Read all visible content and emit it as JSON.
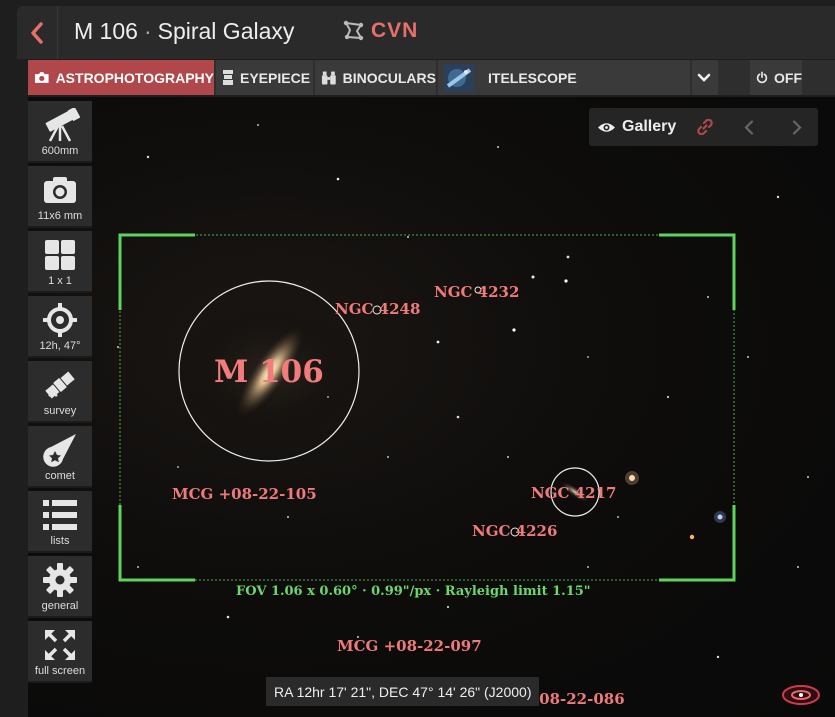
{
  "header": {
    "object_name": "M 106",
    "separator": "·",
    "object_type": "Spiral Galaxy",
    "constellation": "CVN"
  },
  "modes": [
    {
      "label": "ASTROPHOTOGRAPHY",
      "icon": "camera-icon",
      "active": true
    },
    {
      "label": "EYEPIECE",
      "icon": "eyepiece-icon",
      "active": false
    },
    {
      "label": "BINOCULARS",
      "icon": "binoculars-icon",
      "active": false
    },
    {
      "label": "ITELESCOPE",
      "icon": "itelescope-icon",
      "active": false
    }
  ],
  "power": {
    "label": "OFF"
  },
  "sidebar": [
    {
      "label": "600mm",
      "icon": "telescope-icon"
    },
    {
      "label": "11x6 mm",
      "icon": "camera-icon"
    },
    {
      "label": "1 x 1",
      "icon": "grid-icon"
    },
    {
      "label": "12h, 47°",
      "icon": "crosshair-icon"
    },
    {
      "label": "survey",
      "icon": "satellite-icon"
    },
    {
      "label": "comet",
      "icon": "comet-icon"
    },
    {
      "label": "lists",
      "icon": "list-icon"
    },
    {
      "label": "general",
      "icon": "gear-icon"
    },
    {
      "label": "full screen",
      "icon": "fullscreen-icon"
    }
  ],
  "gallery": {
    "label": "Gallery"
  },
  "objects": {
    "main": "M 106",
    "ngc4248": "NGC 4248",
    "ngc4232": "NGC 4232",
    "ngc4217": "NGC 4217",
    "ngc4226": "NGC 4226",
    "mcg105": "MCG +08-22-105",
    "mcg097": "MCG +08-22-097",
    "mcg086": "MCG +08-22-086"
  },
  "fov": "FOV 1.06 x 0.60° · 0.99\"/px · Rayleigh limit 1.15\"",
  "coordinates": "RA 12hr 17' 21\", DEC 47° 14' 26\" (J2000)",
  "colors": {
    "accent": "#b0474a",
    "label": "#f07a7a",
    "frame": "#5ed35e"
  }
}
